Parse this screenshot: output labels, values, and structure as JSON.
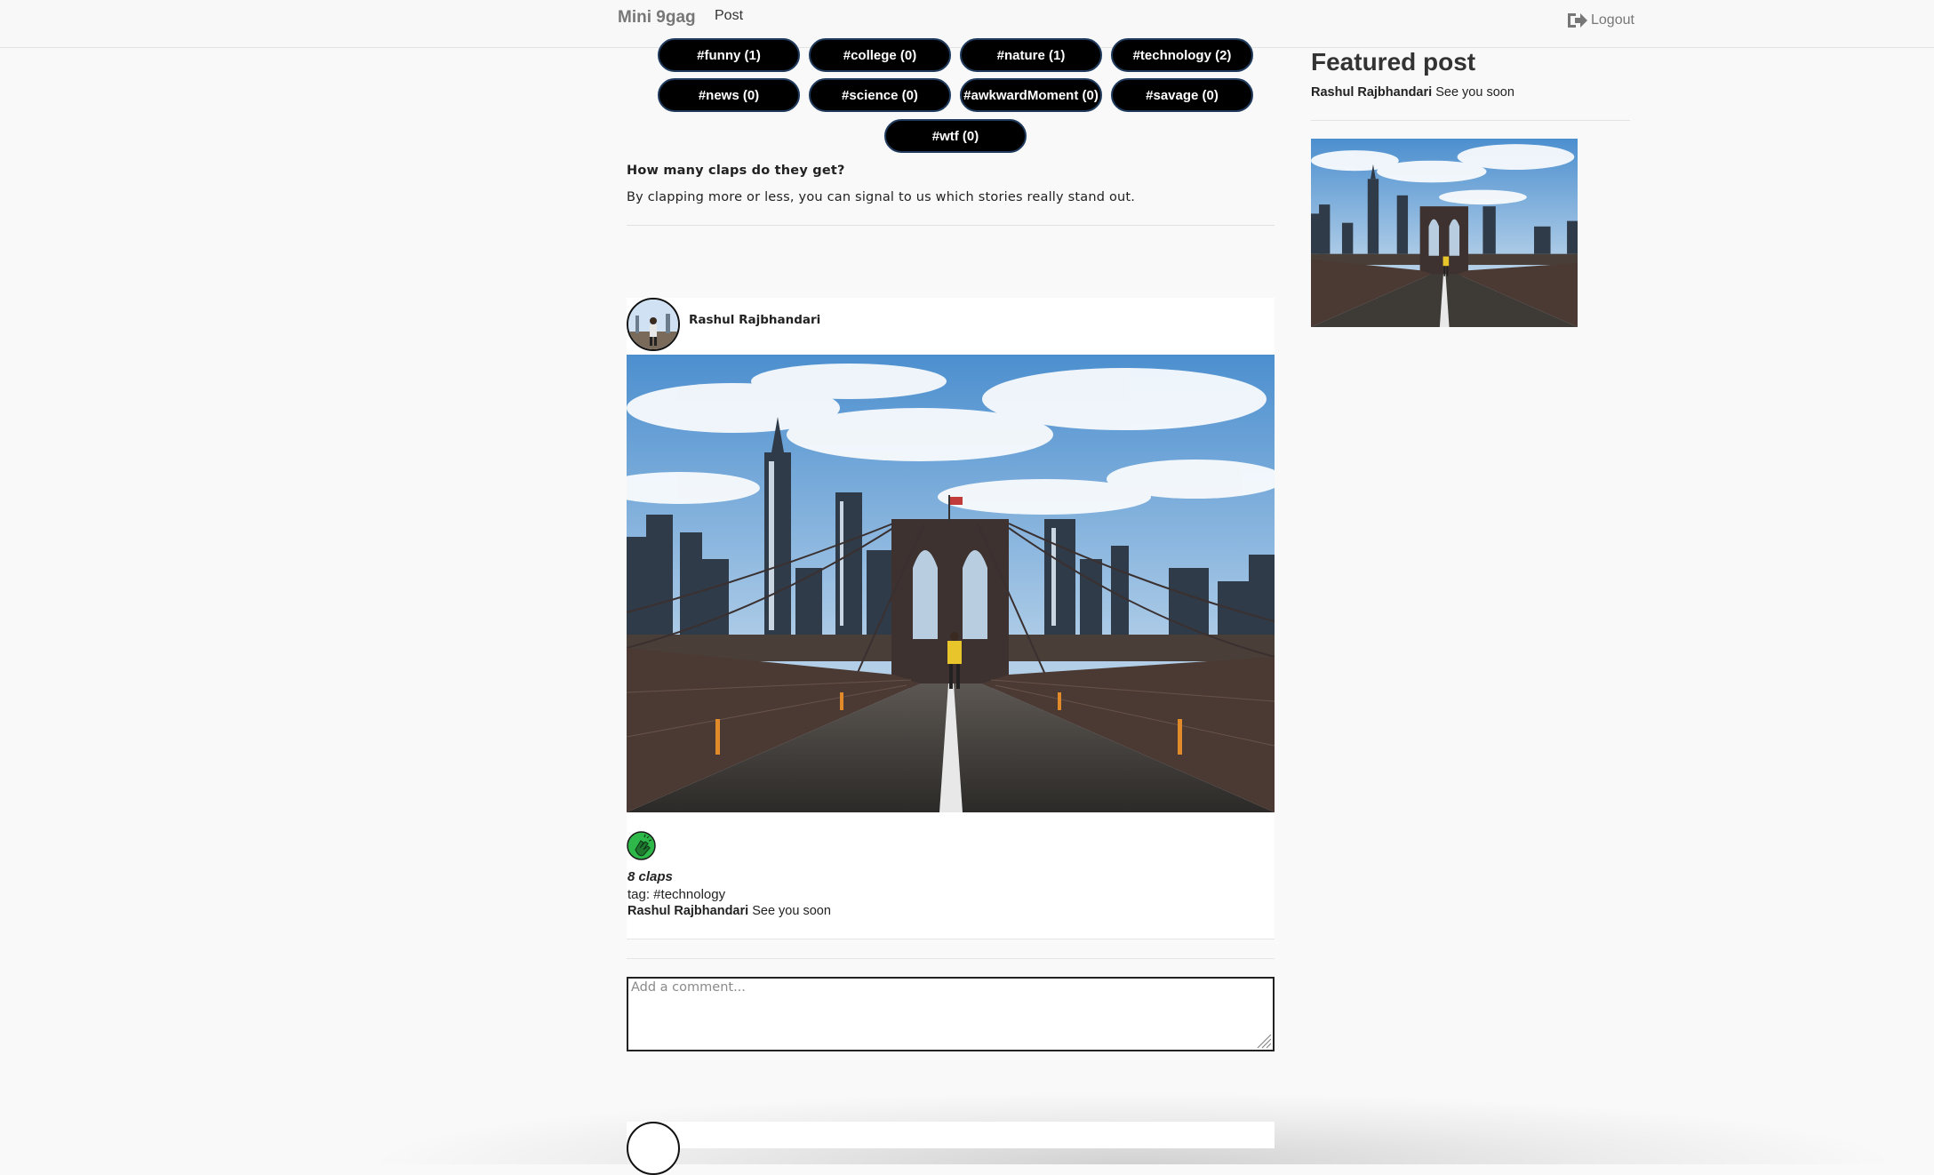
{
  "navbar": {
    "brand": "Mini 9gag",
    "post_link": "Post",
    "logout_label": "Logout",
    "logout_icon": "sign-out-icon"
  },
  "tags": [
    {
      "label": "#funny (1)"
    },
    {
      "label": "#college (0)"
    },
    {
      "label": "#nature (1)"
    },
    {
      "label": "#technology (2)"
    },
    {
      "label": "#news (0)"
    },
    {
      "label": "#science (0)"
    },
    {
      "label": "#awkwardMoment (0)"
    },
    {
      "label": "#savage (0)"
    },
    {
      "label": "#wtf (0)"
    }
  ],
  "info": {
    "question": "How many claps do they get?",
    "answer": "By clapping more or less, you can signal to us which stories really stand out."
  },
  "post": {
    "author": "Rashul Rajbhandari",
    "claps": "8 claps",
    "tag": "tag: #technology",
    "caption_author": "Rashul Rajbhandari",
    "caption_text": "See you soon",
    "clap_icon": "clap-hands-icon",
    "comment_placeholder": "Add a comment..."
  },
  "sidebar": {
    "title": "Featured post",
    "author": "Rashul Rajbhandari",
    "text": "See you soon"
  },
  "colors": {
    "tag_bg": "#000000",
    "tag_border": "#1f3a5c",
    "clap_green": "#2fb84a",
    "page_bg": "#f9f9f9"
  }
}
